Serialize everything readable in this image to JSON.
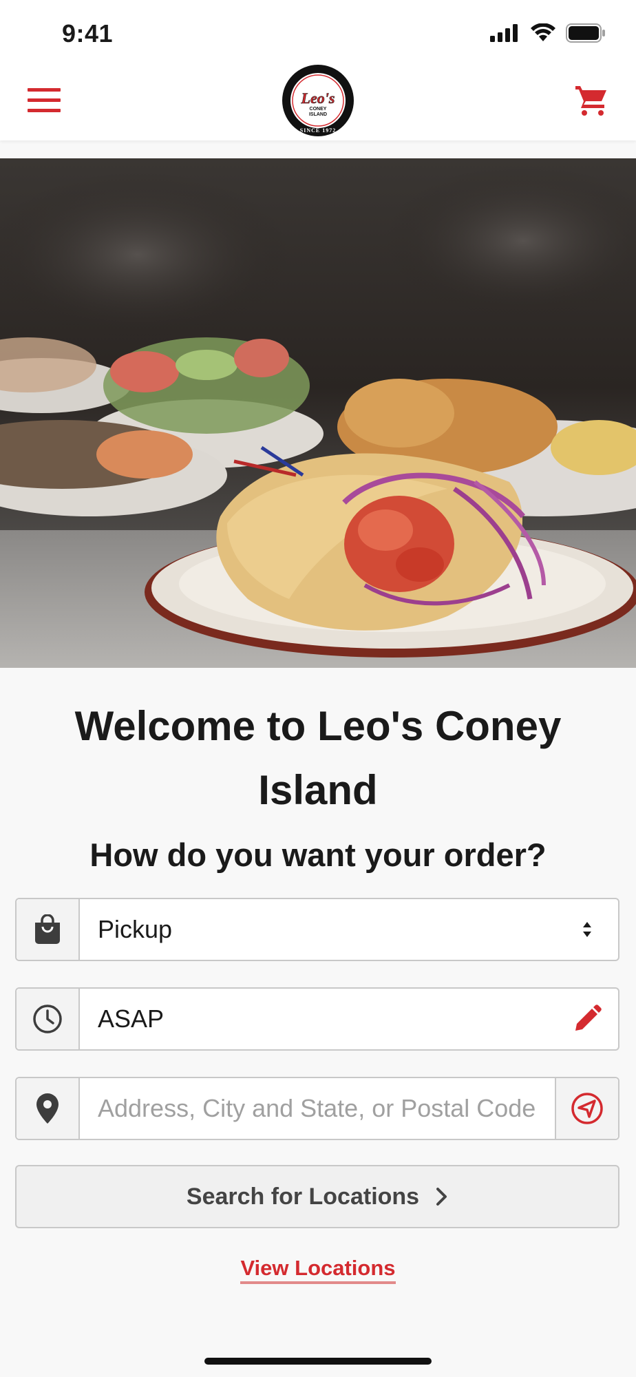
{
  "status_bar": {
    "time": "9:41",
    "icons": [
      "signal-icon",
      "wifi-icon",
      "battery-icon"
    ]
  },
  "header": {
    "menu_icon": "hamburger-menu-icon",
    "cart_icon": "cart-icon",
    "logo": {
      "brand": "Leo's",
      "line1": "CONEY",
      "line2": "ISLAND",
      "since": "SINCE 1972"
    }
  },
  "hero": {
    "description_icon": "food-photo"
  },
  "welcome": {
    "title_line1": "Welcome to Leo's Coney",
    "title_line2": "Island",
    "question": "How do you want your order?"
  },
  "order_form": {
    "mode": {
      "icon": "shopping-bag-icon",
      "value": "Pickup",
      "right_icon": "select-arrows-icon"
    },
    "time": {
      "icon": "clock-icon",
      "value": "ASAP",
      "right_icon": "pencil-icon"
    },
    "address": {
      "icon": "location-pin-icon",
      "value": "",
      "placeholder": "Address, City and State, or Postal Code",
      "right_icon": "locate-me-icon"
    },
    "search_label": "Search for Locations",
    "view_locations_label": "View Locations"
  },
  "colors": {
    "brand_red": "#d42a2f",
    "border_gray": "#c8c8c8",
    "background": "#f8f8f8"
  }
}
